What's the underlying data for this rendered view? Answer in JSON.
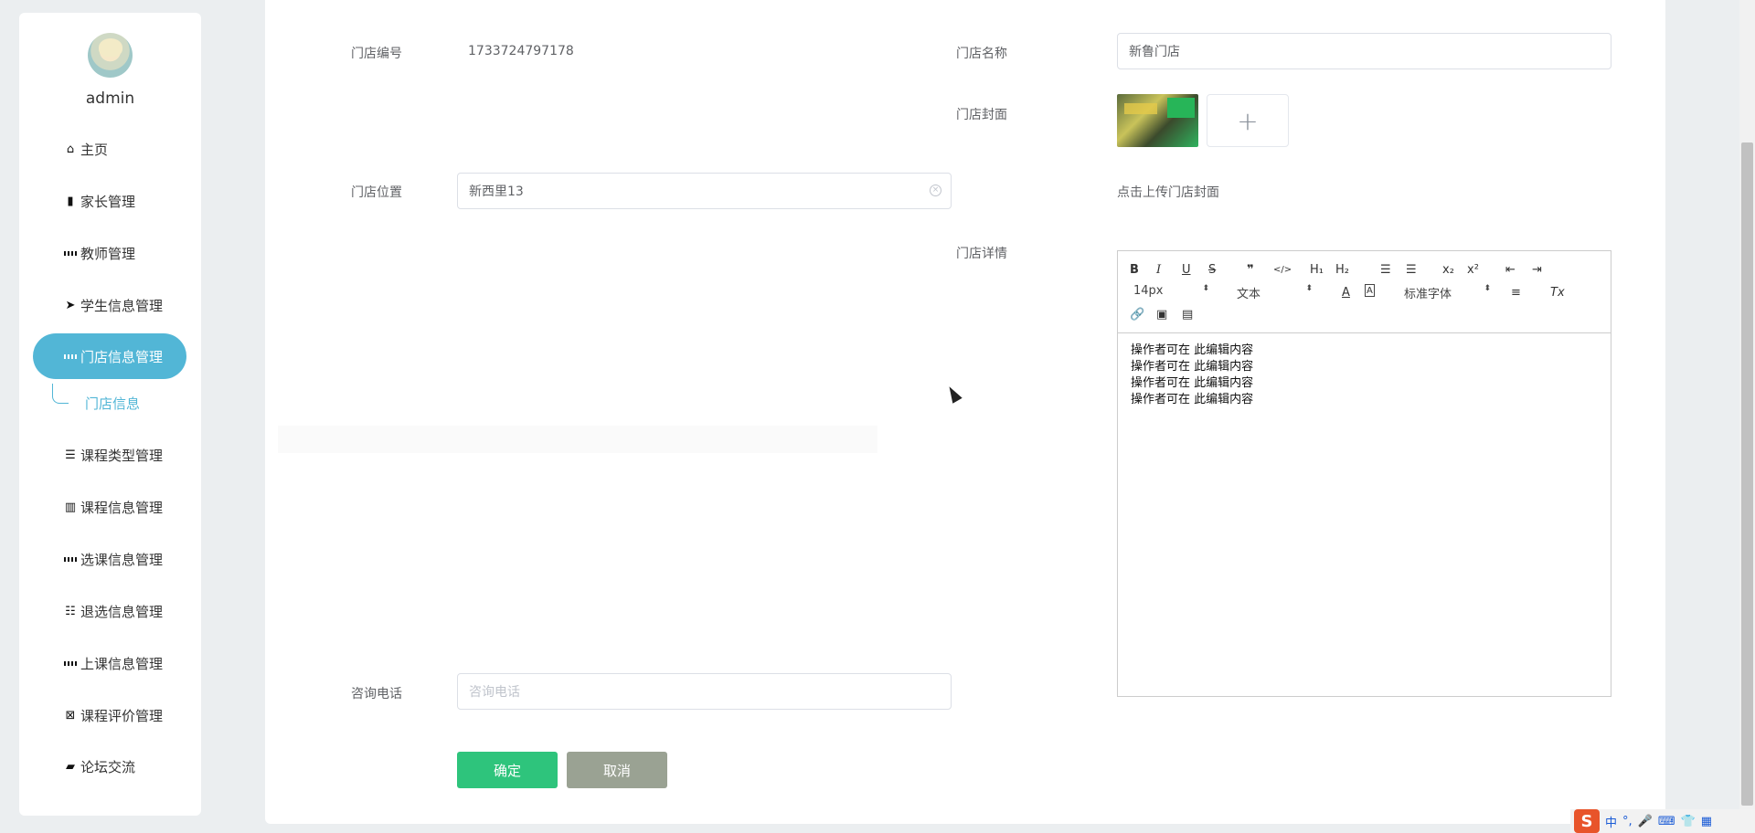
{
  "sidebar": {
    "username": "admin",
    "items": [
      {
        "label": "主页",
        "icon": "home-icon"
      },
      {
        "label": "家长管理",
        "icon": "clipboard-icon"
      },
      {
        "label": "教师管理",
        "icon": "grid-icon"
      },
      {
        "label": "学生信息管理",
        "icon": "paper-plane-icon"
      },
      {
        "label": "门店信息管理",
        "icon": "grid-icon",
        "active": true
      },
      {
        "label": "课程类型管理",
        "icon": "list-icon"
      },
      {
        "label": "课程信息管理",
        "icon": "books-icon"
      },
      {
        "label": "选课信息管理",
        "icon": "grid-icon"
      },
      {
        "label": "退选信息管理",
        "icon": "sliders-icon"
      },
      {
        "label": "上课信息管理",
        "icon": "grid-icon"
      },
      {
        "label": "课程评价管理",
        "icon": "clipboard-x-icon"
      },
      {
        "label": "论坛交流",
        "icon": "ticket-icon"
      }
    ],
    "submenu_label": "门店信息"
  },
  "form": {
    "store_no_label": "门店编号",
    "store_no_value": "1733724797178",
    "store_name_label": "门店名称",
    "store_name_value": "新鲁门店",
    "cover_label": "门店封面",
    "cover_tip": "点击上传门店封面",
    "location_label": "门店位置",
    "location_value": "新西里13",
    "detail_label": "门店详情",
    "phone_label": "咨询电话",
    "phone_placeholder": "咨询电话"
  },
  "editor": {
    "font_size": "14px",
    "header_select": "文本",
    "font_family": "标准字体",
    "lines": [
      "操作者可在 此编辑内容",
      "操作者可在 此编辑内容",
      "操作者可在 此编辑内容",
      "操作者可在 此编辑内容"
    ]
  },
  "buttons": {
    "confirm": "确定",
    "cancel": "取消"
  },
  "ime": {
    "lang": "中"
  },
  "colors": {
    "accent": "#52b6d6",
    "confirm": "#2ec47c",
    "cancel": "#9aa293"
  }
}
